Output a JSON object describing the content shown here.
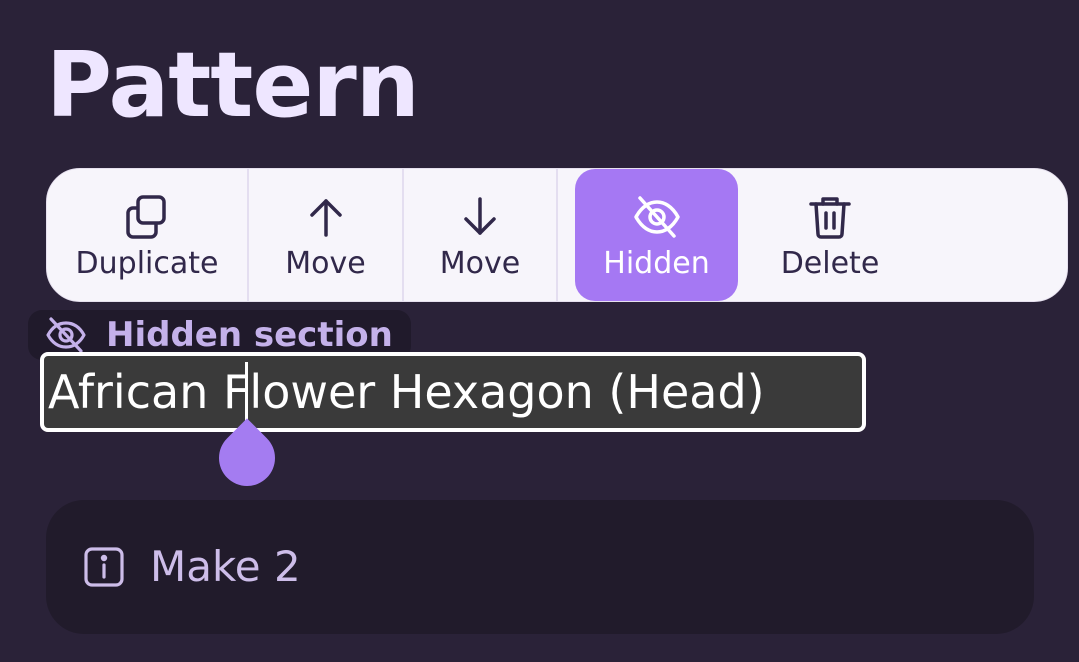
{
  "page": {
    "title": "Pattern"
  },
  "toolbar": {
    "items": [
      {
        "label": "Duplicate",
        "icon": "duplicate-icon"
      },
      {
        "label": "Move",
        "icon": "arrow-up-icon"
      },
      {
        "label": "Move",
        "icon": "arrow-down-icon"
      },
      {
        "label": "Hidden",
        "icon": "eye-off-icon",
        "active": true
      },
      {
        "label": "Delete",
        "icon": "trash-icon"
      }
    ]
  },
  "section": {
    "hidden_badge": "Hidden section",
    "title_value": "African Flower Hexagon (Head)"
  },
  "note": {
    "text": "Make 2",
    "icon": "info-icon"
  },
  "colors": {
    "background": "#2a2238",
    "accent": "#a578f3",
    "toolbar": "#f7f5fb"
  }
}
